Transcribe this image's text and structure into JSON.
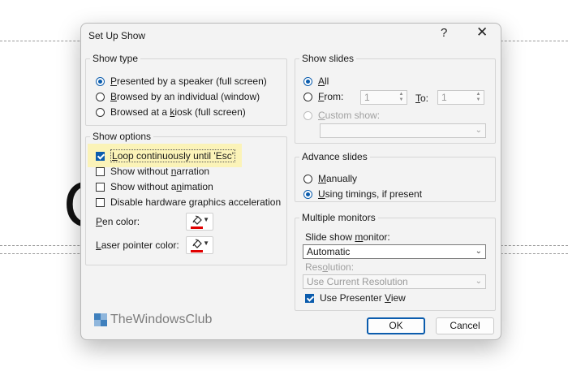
{
  "dialog": {
    "title": "Set Up Show",
    "help_glyph": "?",
    "close_glyph": "✕"
  },
  "show_type": {
    "legend": "Show type",
    "options": [
      {
        "pre": "",
        "key": "P",
        "post": "resented by a speaker (full screen)",
        "selected": true
      },
      {
        "pre": "",
        "key": "B",
        "post": "rowsed by an individual (window)",
        "selected": false
      },
      {
        "pre": "Browsed at a ",
        "key": "k",
        "post": "iosk (full screen)",
        "selected": false
      }
    ]
  },
  "show_options": {
    "legend": "Show options",
    "checks": [
      {
        "pre": "",
        "key": "L",
        "post": "oop continuously until 'Esc'",
        "checked": true
      },
      {
        "pre": "Show without ",
        "key": "n",
        "post": "arration",
        "checked": false
      },
      {
        "pre": "Show without a",
        "key": "n",
        "post": "imation",
        "checked": false
      },
      {
        "pre": "Disable hardware ",
        "key": "g",
        "post": "raphics acceleration",
        "checked": false
      }
    ],
    "pen_color": {
      "pre": "",
      "key": "P",
      "post": "en color:",
      "color": "#e00000"
    },
    "laser_color": {
      "pre": "",
      "key": "L",
      "post": "aser pointer color:",
      "color": "#e00000"
    }
  },
  "show_slides": {
    "legend": "Show slides",
    "all": {
      "key": "A",
      "post": "ll",
      "selected": true
    },
    "from": {
      "key": "F",
      "post": "rom:",
      "value": "1",
      "selected": false
    },
    "to": {
      "key": "T",
      "post": "o:",
      "value": "1"
    },
    "custom": {
      "key": "C",
      "post": "ustom show:",
      "value": "",
      "enabled": false
    }
  },
  "advance_slides": {
    "legend": "Advance slides",
    "options": [
      {
        "pre": "",
        "key": "M",
        "post": "anually",
        "selected": false
      },
      {
        "pre": "",
        "key": "U",
        "post": "sing timings, if present",
        "selected": true
      }
    ]
  },
  "monitors": {
    "legend": "Multiple monitors",
    "monitor_label": {
      "pre": "Slide show ",
      "key": "m",
      "post": "onitor:"
    },
    "monitor_value": "Automatic",
    "resolution_label": {
      "pre": "Res",
      "key": "o",
      "post": "lution:"
    },
    "resolution_value": "Use Current Resolution",
    "presenter_view": {
      "pre": "Use Presenter ",
      "key": "V",
      "post": "iew",
      "checked": true
    }
  },
  "buttons": {
    "ok": "OK",
    "cancel": "Cancel"
  },
  "watermark": {
    "text": "TheWindowsClub"
  },
  "background": {
    "glyph": "C"
  },
  "colors": {
    "accent": "#0b5cad",
    "highlight": "#fbf3b8",
    "pen_red": "#e00000"
  }
}
